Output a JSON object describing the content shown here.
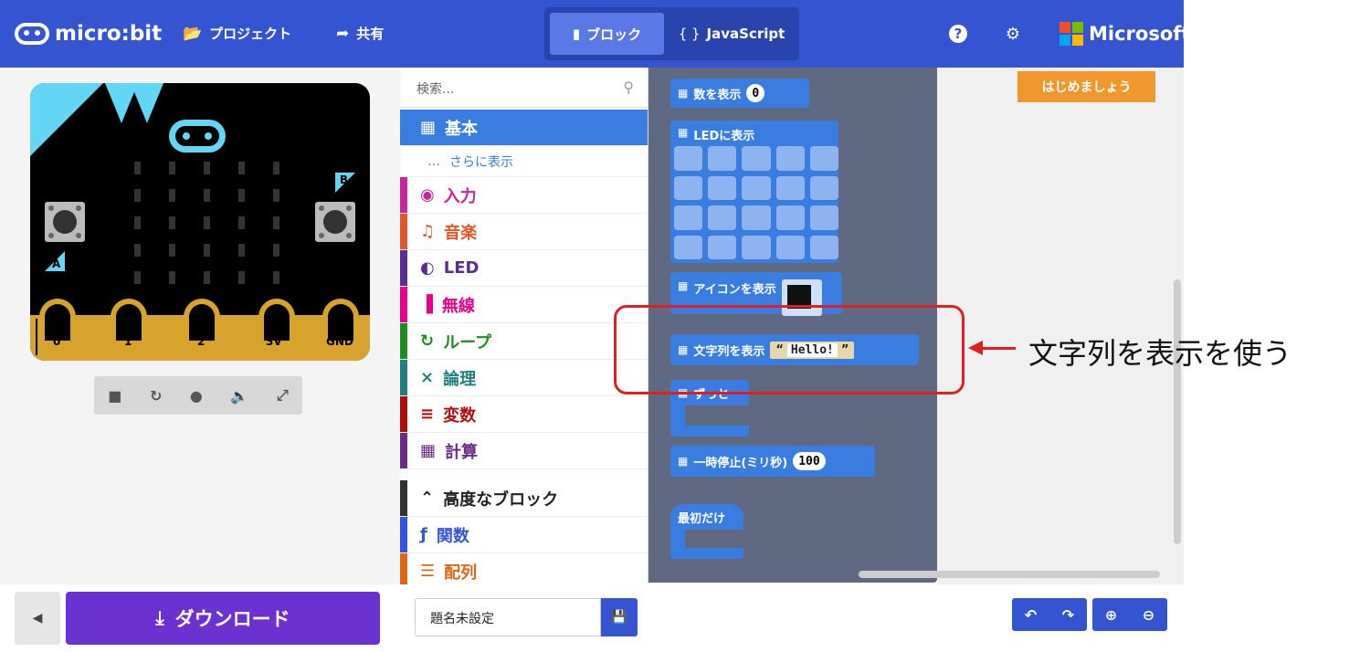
{
  "header": {
    "logo_text": "micro:bit",
    "projects_label": "プロジェクト",
    "share_label": "共有",
    "blocks_tab": "ブロック",
    "javascript_tab": "JavaScript",
    "help_icon": "question-circle-icon",
    "settings_icon": "gear-icon",
    "brand": "Microsoft"
  },
  "simulator": {
    "button_a": "A",
    "button_b": "B",
    "pins": [
      "0",
      "1",
      "2",
      "3V",
      "GND"
    ],
    "controls": [
      "stop-icon",
      "restart-icon",
      "slowmo-icon",
      "mute-icon",
      "fullscreen-icon"
    ]
  },
  "toolbox": {
    "search_placeholder": "検索...",
    "categories": [
      {
        "label": "基本",
        "color": "#3a7de0"
      },
      {
        "label": "さらに表示",
        "color": "#3a7de0"
      },
      {
        "label": "入力",
        "color": "#c7259b"
      },
      {
        "label": "音楽",
        "color": "#e0572a"
      },
      {
        "label": "LED",
        "color": "#5c2d91"
      },
      {
        "label": "無線",
        "color": "#e3008c"
      },
      {
        "label": "ループ",
        "color": "#1f8c22"
      },
      {
        "label": "論理",
        "color": "#217f7f"
      },
      {
        "label": "変数",
        "color": "#b00e0e"
      },
      {
        "label": "計算",
        "color": "#6a2a85"
      },
      {
        "label": "高度なブロック",
        "color": "#333333"
      },
      {
        "label": "関数",
        "color": "#3455db"
      },
      {
        "label": "配列",
        "color": "#e06717"
      }
    ]
  },
  "flyout": {
    "show_number": "数を表示",
    "show_number_value": "0",
    "show_leds": "LEDに表示",
    "show_icon": "アイコンを表示",
    "show_string": "文字列を表示",
    "show_string_value": "Hello!",
    "forever": "ずっと",
    "pause": "一時停止(ミリ秒)",
    "pause_value": "100",
    "on_start": "最初だけ"
  },
  "workspace": {
    "get_started": "はじめましょう"
  },
  "bottom": {
    "download_label": "ダウンロード",
    "project_name": "題名未設定"
  },
  "annotation": {
    "text": "文字列を表示を使う",
    "color": "#e02020"
  }
}
